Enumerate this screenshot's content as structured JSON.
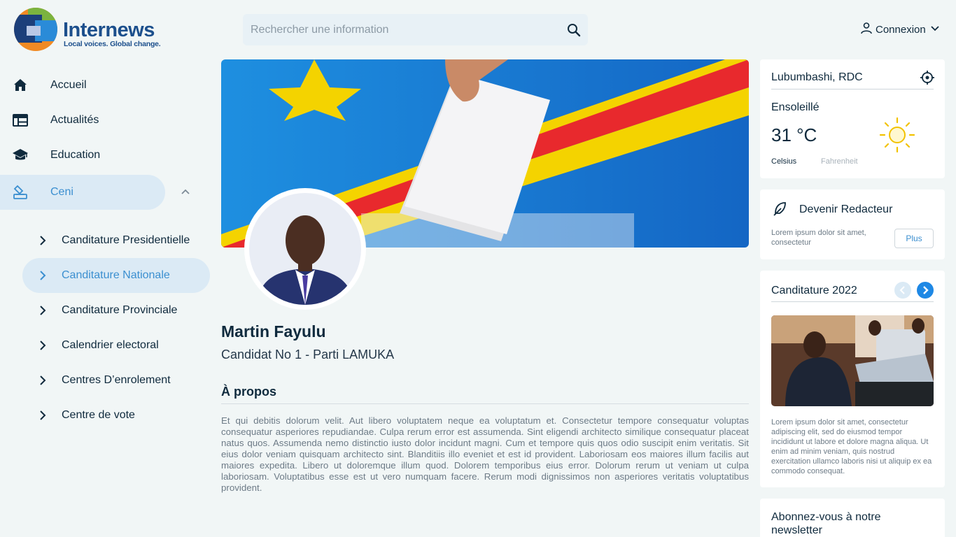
{
  "brand": {
    "name": "Internews",
    "tagline": "Local voices. Global change."
  },
  "search": {
    "placeholder": "Rechercher une information",
    "value": ""
  },
  "account": {
    "login_label": "Connexion"
  },
  "sidebar": {
    "items": [
      {
        "label": "Accueil",
        "icon": "home-icon"
      },
      {
        "label": "Actualités",
        "icon": "news-icon"
      },
      {
        "label": "Education",
        "icon": "school-icon"
      },
      {
        "label": "Ceni",
        "icon": "ballot-icon",
        "active": true,
        "expanded": true
      }
    ],
    "subitems": [
      {
        "label": "Canditature Presidentielle"
      },
      {
        "label": "Canditature Nationale",
        "active": true
      },
      {
        "label": "Canditature Provinciale"
      },
      {
        "label": "Calendrier electoral"
      },
      {
        "label": "Centres D’enrolement"
      },
      {
        "label": "Centre de vote"
      }
    ]
  },
  "candidate": {
    "name": "Martin Fayulu",
    "subtitle": "Candidat No 1 - Parti LAMUKA",
    "about_title": "À propos",
    "about_text": "Et qui debitis dolorum velit. Aut libero voluptatem neque ea voluptatum et. Consectetur tempore consequatur voluptas consequatur asperiores repudiandae. Culpa rerum error est assumenda. Sint eligendi architecto similique consequatur placeat natus quos. Assumenda nemo distinctio iusto dolor incidunt magni. Cum et tempore quis quos odio suscipit enim veritatis. Sit eius dolor veniam quisquam architecto sint. Blanditiis illo eveniet et est id provident. Laboriosam eos maiores illum facilis aut maiores expedita. Libero ut doloremque illum quod. Dolorem temporibus eius error. Dolorum rerum ut veniam ut culpa laboriosam. Voluptatibus esse est ut vero numquam facere. Rerum modi dignissimos non asperiores veritatis voluptatibus provident."
  },
  "weather": {
    "city": "Lubumbashi, RDC",
    "condition": "Ensoleillé",
    "temperature": "31 °C",
    "unit_active": "Celsius",
    "unit_inactive": "Fahrenheit"
  },
  "writer_card": {
    "title": "Devenir Redacteur",
    "description": "Lorem ipsum dolor sit amet, consectetur",
    "button": "Plus"
  },
  "candidatures_card": {
    "title": "Canditature 2022",
    "description": "Lorem ipsum dolor sit amet, consectetur adipiscing elit, sed do eiusmod tempor incididunt ut labore et dolore magna aliqua. Ut enim ad minim veniam, quis nostrud exercitation ullamco laboris nisi ut aliquip ex ea commodo consequat."
  },
  "newsletter_card": {
    "title": "Abonnez-vous à notre newsletter"
  },
  "colors": {
    "accent": "#3b8fd0",
    "active_bg": "#dbeaf5",
    "page_bg": "#f1f6f6",
    "text": "#0f2a3d"
  }
}
